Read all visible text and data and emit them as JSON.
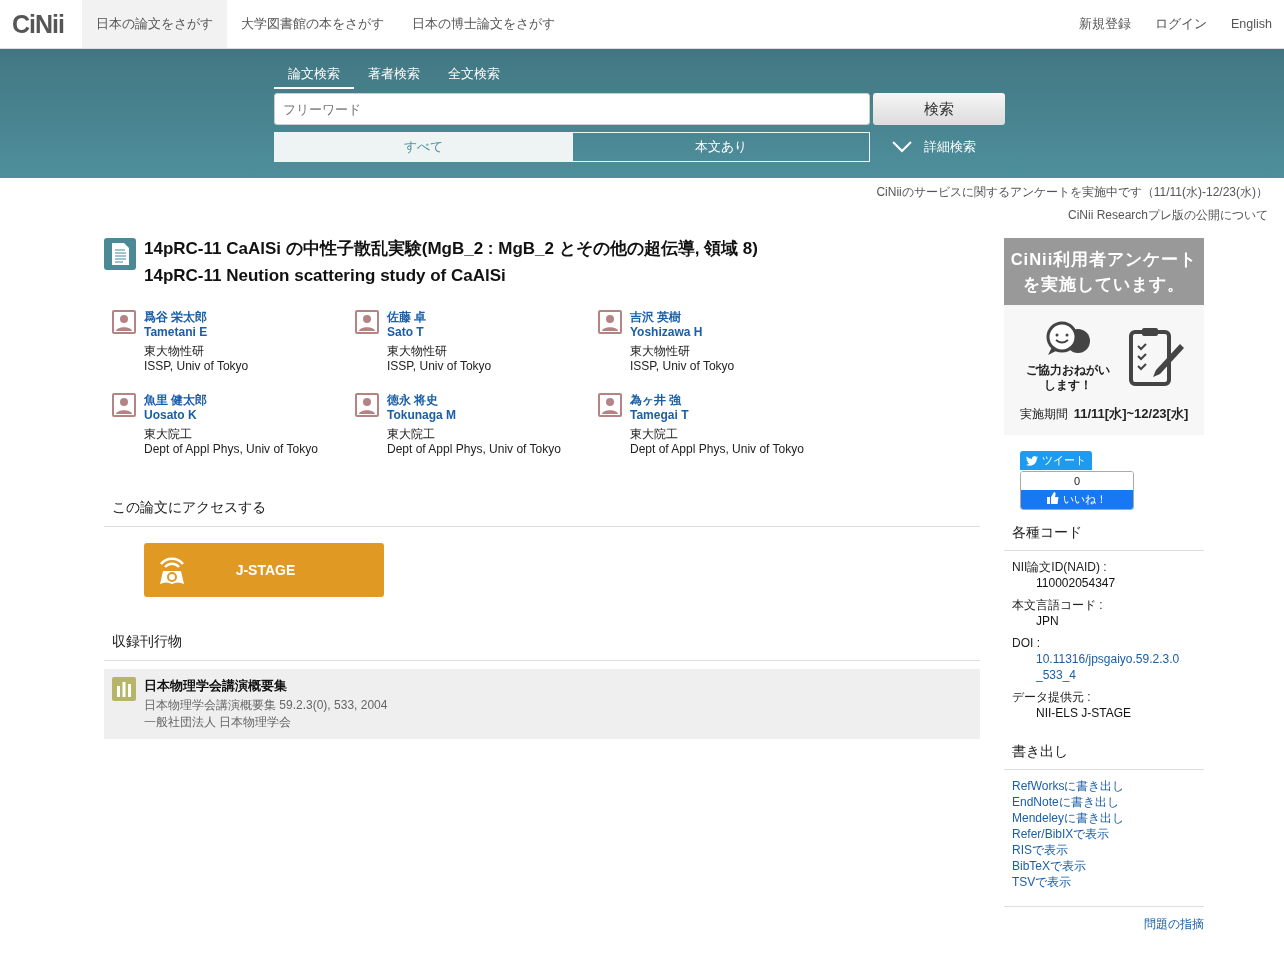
{
  "header": {
    "logo": "CiNii",
    "nav": [
      {
        "label": "日本の論文をさがす",
        "selected": true
      },
      {
        "label": "大学図書館の本をさがす",
        "selected": false
      },
      {
        "label": "日本の博士論文をさがす",
        "selected": false
      }
    ],
    "user_links": [
      "新規登録",
      "ログイン",
      "English"
    ]
  },
  "search": {
    "tabs": [
      {
        "label": "論文検索",
        "selected": true
      },
      {
        "label": "著者検索",
        "selected": false
      },
      {
        "label": "全文検索",
        "selected": false
      }
    ],
    "placeholder": "フリーワード",
    "button": "検索",
    "filters": [
      {
        "label": "すべて",
        "selected": true
      },
      {
        "label": "本文あり",
        "selected": false
      }
    ],
    "advanced": "詳細検索"
  },
  "notices": [
    "CiNiiのサービスに関するアンケートを実施中です（11/11(水)-12/23(水)）",
    "CiNii Researchプレ版の公開について"
  ],
  "article": {
    "title_ja": "14pRC-11 CaAlSi の中性子散乱実験(MgB_2 : MgB_2 とその他の超伝導, 領域 8)",
    "title_en": "14pRC-11 Neution scattering study of CaAlSi",
    "authors": [
      {
        "name_ja": "爲谷 栄太郎",
        "name_en": "Tametani E",
        "affil_ja": "東大物性研",
        "affil_en": "ISSP, Univ of Tokyo"
      },
      {
        "name_ja": "佐藤 卓",
        "name_en": "Sato T",
        "affil_ja": "東大物性研",
        "affil_en": "ISSP, Univ of Tokyo"
      },
      {
        "name_ja": "吉沢 英樹",
        "name_en": "Yoshizawa H",
        "affil_ja": "東大物性研",
        "affil_en": "ISSP, Univ of Tokyo"
      },
      {
        "name_ja": "魚里 健太郎",
        "name_en": "Uosato K",
        "affil_ja": "東大院工",
        "affil_en": "Dept of Appl Phys, Univ of Tokyo"
      },
      {
        "name_ja": "徳永 将史",
        "name_en": "Tokunaga M",
        "affil_ja": "東大院工",
        "affil_en": "Dept of Appl Phys, Univ of Tokyo"
      },
      {
        "name_ja": "為ヶ井 強",
        "name_en": "Tamegai T",
        "affil_ja": "東大院工",
        "affil_en": "Dept of Appl Phys, Univ of Tokyo"
      }
    ]
  },
  "access": {
    "heading": "この論文にアクセスする",
    "button": "J-STAGE"
  },
  "publication": {
    "heading": "収録刊行物",
    "title": "日本物理学会講演概要集",
    "details": "日本物理学会講演概要集 59.2.3(0), 533, 2004",
    "publisher": "一般社団法人 日本物理学会"
  },
  "sidebar": {
    "banner": {
      "title_lines": [
        "CiNii利用者アンケート",
        "を実施しています。"
      ],
      "caption_lines": [
        "ご協力おねがい",
        "します！"
      ],
      "period_label": "実施期間",
      "period": "11/11[水]~12/23[水]"
    },
    "tweet": "ツイート",
    "like": {
      "count": "0",
      "label": "いいね！"
    },
    "codes": {
      "heading": "各種コード",
      "items": [
        {
          "label": "NII論文ID(NAID) :",
          "values": [
            "110002054347"
          ],
          "kind": "text"
        },
        {
          "label": "本文言語コード :",
          "values": [
            "JPN"
          ],
          "kind": "text"
        },
        {
          "label": "DOI :",
          "values": [
            "10.11316/jpsgaiyo.59.2.3.0",
            "_533_4"
          ],
          "kind": "link"
        },
        {
          "label": "データ提供元 :",
          "values": [
            "NII-ELS  J-STAGE"
          ],
          "kind": "text"
        }
      ]
    },
    "export": {
      "heading": "書き出し",
      "links": [
        "RefWorksに書き出し",
        "EndNoteに書き出し",
        "Mendeleyに書き出し",
        "Refer/BibIXで表示",
        "RISで表示",
        "BibTeXで表示",
        "TSVで表示"
      ]
    },
    "report": "問題の指摘"
  }
}
